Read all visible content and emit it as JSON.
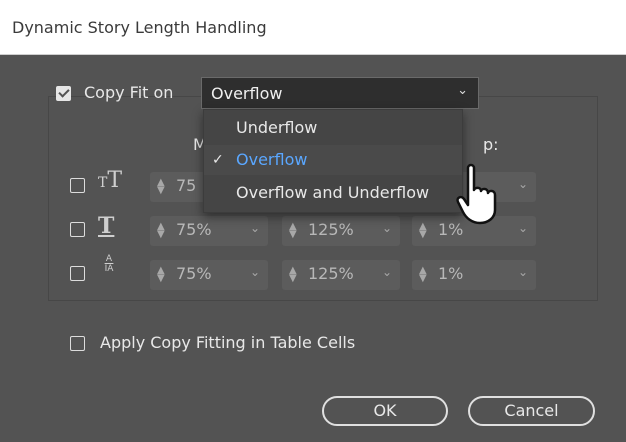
{
  "dialog": {
    "title": "Dynamic Story Length Handling"
  },
  "copy_fit": {
    "checkbox_label": "Copy Fit on",
    "checked": true,
    "selected_value": "Overflow",
    "options": [
      "Underflow",
      "Overflow",
      "Overflow and Underflow"
    ],
    "selected_option": "Overflow"
  },
  "columns": {
    "min_header": "M",
    "step_header": "p:"
  },
  "rows": [
    {
      "name": "font-size",
      "checked": false,
      "min": "75",
      "max": "",
      "step": ""
    },
    {
      "name": "leading",
      "checked": false,
      "min": "75%",
      "max": "125%",
      "step": "1%"
    },
    {
      "name": "tracking",
      "checked": false,
      "min": "75%",
      "max": "125%",
      "step": "1%",
      "icon_label_top": "A",
      "icon_label_bottom": "IA"
    }
  ],
  "table_cells": {
    "label": "Apply Copy Fitting in Table Cells",
    "checked": false
  },
  "buttons": {
    "ok": "OK",
    "cancel": "Cancel"
  },
  "colors": {
    "dialog_bg": "#535353",
    "titlebar_bg": "#ffffff",
    "selected_option_text": "#5aa7ff"
  }
}
